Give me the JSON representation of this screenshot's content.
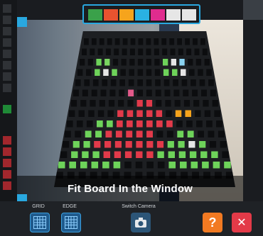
{
  "viewport": {
    "instruction": "Fit Board In the Window"
  },
  "palette": {
    "colors": [
      "#3aa14a",
      "#e8532f",
      "#f6a41c",
      "#2ab1e3",
      "#e02c8e",
      "#e6e6e6",
      "#e6e6e6"
    ]
  },
  "controls": {
    "grid_label": "GRID",
    "edge_label": "EDGE",
    "switch_camera_label": "Switch Camera",
    "help_symbol": "?",
    "close_symbol": "✕"
  },
  "theme": {
    "accent": "#29a8e0",
    "help": "#f27a22",
    "close": "#e33a48"
  }
}
